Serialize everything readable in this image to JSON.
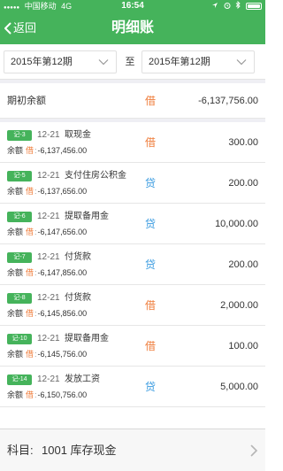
{
  "status_bar": {
    "signal": "●●●●●",
    "carrier": "中国移动",
    "network": "4G",
    "time": "16:54",
    "icons": [
      "location-icon",
      "alarm-icon",
      "bluetooth-icon",
      "battery-icon"
    ]
  },
  "nav": {
    "back_label": "返回",
    "title": "明细账"
  },
  "period": {
    "start": "2015年第12期",
    "separator": "至",
    "end": "2015年第12期"
  },
  "opening_balance": {
    "label": "期初余额",
    "dc": "借",
    "amount": "-6,137,756.00"
  },
  "entries": [
    {
      "voucher": "记-3",
      "date": "12-21",
      "summary": "取现金",
      "dc": "借",
      "amount": "300.00",
      "balance_label": "余额",
      "balance_dc": "借",
      "balance_colon": ":",
      "balance": "-6,137,456.00"
    },
    {
      "voucher": "记-5",
      "date": "12-21",
      "summary": "支付住房公积金",
      "dc": "贷",
      "amount": "200.00",
      "balance_label": "余额",
      "balance_dc": "借",
      "balance_colon": ":",
      "balance": "-6,137,656.00"
    },
    {
      "voucher": "记-6",
      "date": "12-21",
      "summary": "提取备用金",
      "dc": "贷",
      "amount": "10,000.00",
      "balance_label": "余额",
      "balance_dc": "借",
      "balance_colon": ":",
      "balance": "-6,147,656.00"
    },
    {
      "voucher": "记-7",
      "date": "12-21",
      "summary": "付货款",
      "dc": "贷",
      "amount": "200.00",
      "balance_label": "余额",
      "balance_dc": "借",
      "balance_colon": ":",
      "balance": "-6,147,856.00"
    },
    {
      "voucher": "记-8",
      "date": "12-21",
      "summary": "付货款",
      "dc": "借",
      "amount": "2,000.00",
      "balance_label": "余额",
      "balance_dc": "借",
      "balance_colon": ":",
      "balance": "-6,145,856.00"
    },
    {
      "voucher": "记-10",
      "date": "12-21",
      "summary": "提取备用金",
      "dc": "借",
      "amount": "100.00",
      "balance_label": "余额",
      "balance_dc": "借",
      "balance_colon": ":",
      "balance": "-6,145,756.00"
    },
    {
      "voucher": "记-14",
      "date": "12-21",
      "summary": "发放工资",
      "dc": "贷",
      "amount": "5,000.00",
      "balance_label": "余额",
      "balance_dc": "借",
      "balance_colon": ":",
      "balance": "-6,150,756.00"
    }
  ],
  "footer": {
    "label": "科目:",
    "value": "1001 库存现金"
  },
  "colors": {
    "accent": "#45b35b",
    "debit": "#ef7c3a",
    "credit": "#3a9be0"
  }
}
